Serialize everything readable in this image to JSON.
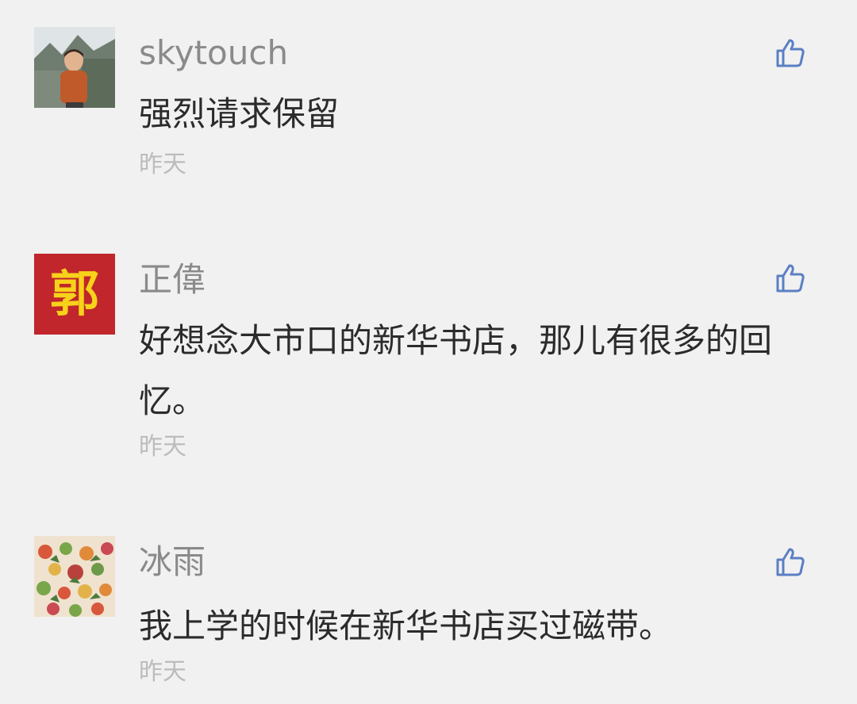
{
  "comments": [
    {
      "username": "skytouch",
      "content": "强烈请求保留",
      "time": "昨天",
      "avatar_icon": "photo-avatar-child"
    },
    {
      "username": "正偉",
      "content": "好想念大市口的新华书店，那儿有很多的回忆。",
      "time": "昨天",
      "avatar_icon": "red-seal-avatar",
      "avatar_text": "郭"
    },
    {
      "username": "冰雨",
      "content": "我上学的时候在新华书店买过磁带。",
      "time": "昨天",
      "avatar_icon": "pattern-avatar"
    }
  ],
  "icons": {
    "like": "thumbs-up-icon"
  },
  "colors": {
    "background": "#f1f1f1",
    "username": "#8a8a8a",
    "content": "#2b2b2b",
    "time": "#bcbcbc",
    "like_icon": "#5b7fc4",
    "seal_red": "#c0262b",
    "seal_text": "#f7d21a"
  }
}
